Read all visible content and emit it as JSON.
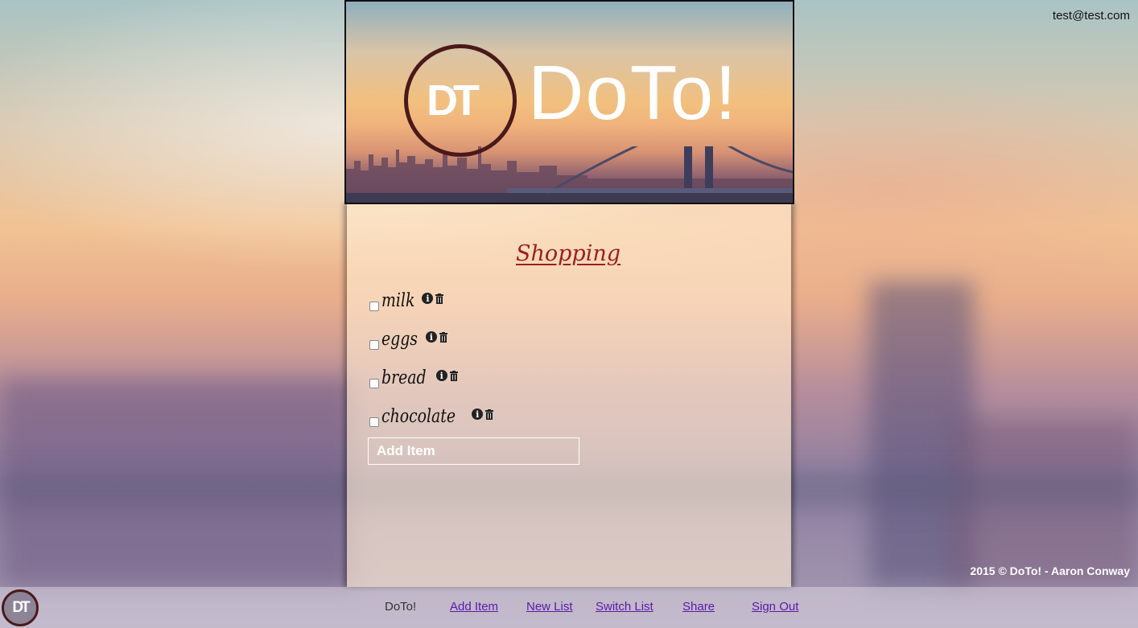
{
  "user": {
    "email": "test@test.com"
  },
  "hero": {
    "logo_mark": "DT",
    "logo_text": "DoTo!"
  },
  "list": {
    "title": "Shopping",
    "items": [
      {
        "label": "milk",
        "checked": false
      },
      {
        "label": "eggs",
        "checked": false
      },
      {
        "label": "bread",
        "checked": false
      },
      {
        "label": "chocolate",
        "checked": false
      }
    ],
    "add_placeholder": "Add Item"
  },
  "footer": {
    "copyright": "2015 © DoTo! - Aaron Conway"
  },
  "navbar": {
    "logo_mark": "DT",
    "brand": "DoTo!",
    "add_item": "Add Item",
    "new_list": "New List",
    "switch_list": "Switch List",
    "share": "Share",
    "sign_out": "Sign Out"
  },
  "icons": {
    "info": "info-icon",
    "trash": "trash-icon"
  },
  "colors": {
    "title": "#9a2020",
    "link": "#5a1aa8",
    "logo_ring": "#4a1a1a"
  }
}
